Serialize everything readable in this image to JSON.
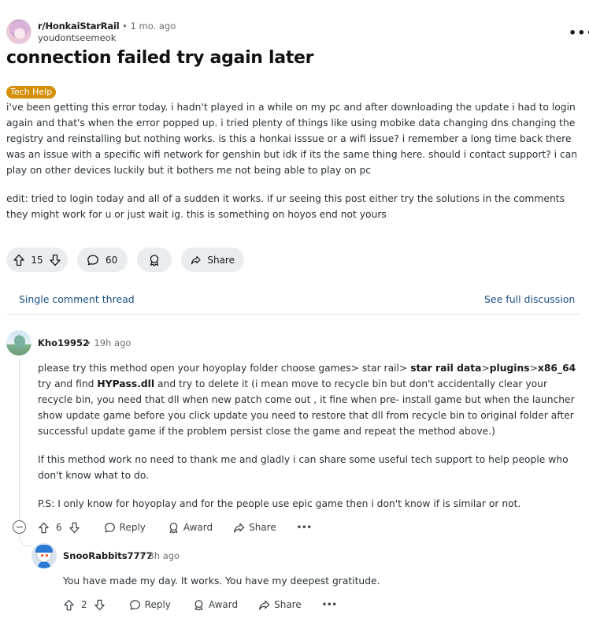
{
  "post": {
    "subreddit": "r/HonkaiStarRail",
    "separator": "•",
    "age": "1 mo. ago",
    "author": "youdontseemeok",
    "more": "•••",
    "title": "connection failed try again later",
    "flair": "Tech Help",
    "body_p1": "i've been getting this error today. i hadn't played in a while on my pc and after downloading the update i had to login again and that's when the error popped up. i tried plenty of things like using mobike data changing dns changing the registry and reinstalling but nothing works. is this a honkai isssue or a wifi issue? i remember a long time back there was an issue with a specific wifi network for genshin but idk if its the same thing here. should i contact support? i can play on other devices luckily but it bothers me not being able to play on pc",
    "body_p2": "edit: tried to login today and all of a sudden it works. if ur seeing this post either try the solutions in the comments they might work for u or just wait ig. this is something on hoyos end not yours",
    "votes": "15",
    "comments": "60",
    "share_label": "Share"
  },
  "thread_nav": {
    "single": "Single comment thread",
    "full": "See full discussion"
  },
  "comment": {
    "author": "Kho19952",
    "meta": "• 19h ago",
    "p1_a": "please try this method open your hoyoplay folder choose games> star rail> ",
    "p1_b1": "star rail data",
    "p1_c": ">",
    "p1_b2": "plugins",
    "p1_d": ">",
    "p1_b3": "x86_64",
    "p1_e": " try and find ",
    "p1_b4": "HYPass.dll",
    "p1_f": " and try to delete it (i mean move to recycle bin but don't accidentally clear your recycle bin, you need that dll when new patch come out , it fine when pre- install game but when the launcher show update game before you click update you need to restore that dll from recycle bin to original folder after successful update game if the problem persist close the game and repeat the method above.)",
    "p2": "If this method work no need to thank me and gladly i can share some useful tech support to help people who don't know what to do.",
    "p3": "P.S: I only know for hoyoplay and for the people use epic game then i don't know if is similar or not.",
    "votes": "6",
    "reply_label": "Reply",
    "award_label": "Award",
    "share_label": "Share",
    "more": "•••"
  },
  "reply": {
    "author": "SnooRabbits7777",
    "meta": "• 3h ago",
    "body": "You have made my day. It works. You have my deepest gratitude.",
    "votes": "2",
    "reply_label": "Reply",
    "award_label": "Award",
    "share_label": "Share",
    "more": "•••"
  },
  "colors": {
    "flair_bg": "#d4900d",
    "link": "#1a4f85",
    "pill_bg": "#e9edf0"
  }
}
